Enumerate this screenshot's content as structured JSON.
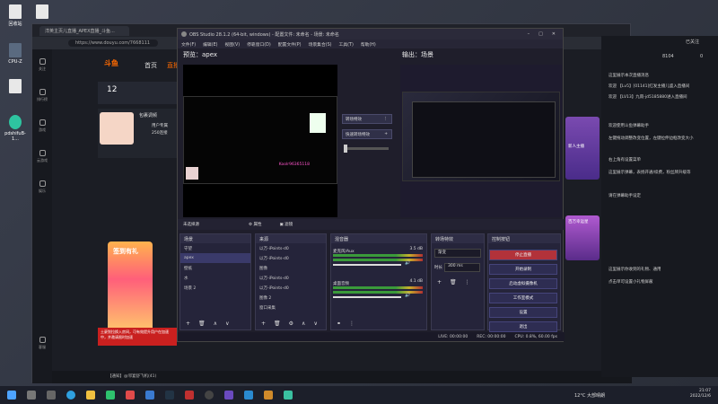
{
  "desktop": {
    "icons": [
      {
        "label": "回收站"
      },
      {
        "label": "CPU-Z"
      },
      {
        "label": "pdshifuB-1..."
      }
    ]
  },
  "browser": {
    "tab_title": "洋英主页儿直播_APEX直播_斗鱼...",
    "url": "https://www.douyu.com/7668111",
    "douyu": {
      "nav": [
        "首页",
        "直播"
      ],
      "sidebar": [
        "关注",
        "排行榜",
        "游戏",
        "云游戏",
        "娱乐",
        "客服"
      ],
      "stat_number": "12",
      "card_title": "包裹调频",
      "card_lines": [
        "用户专属",
        "250连接"
      ],
      "promo": "签到有礼",
      "toast": "土豪划拉换入房间，可有效提升用户在加速中，并邀请限时加速",
      "bottom_text": "【通知】@邻宴舒飞机(41)"
    }
  },
  "chat": {
    "header": "已关注",
    "lines": [
      "这里展示本次直播消息",
      "欢迎 【Lv5】[01141]红发主播儿盛入直播间",
      "欢迎 【LV13】九雨-jd5185880进入直播间",
      "欢迎使用斗鱼弹幕助手",
      "左键拖动调整改变位置，左键拉伸边框改变大小",
      "右上角有设置菜单",
      "这里展示弹幕，表扬开通/续费，粉丝牌升级等",
      "请在弹幕助手设定",
      "这里展示你收到的礼物、通用",
      "点击单可设置小礼物屏蔽"
    ],
    "banner_1": "新人主播",
    "banner_2": "百万幸运星",
    "counts": [
      "8104",
      "0"
    ]
  },
  "obs": {
    "title": "OBS Studio 28.1.2 (64-bit, windows) - 配置文件: 未命名 - 场景: 未命名",
    "menu": [
      "文件(F)",
      "编辑(E)",
      "视图(V)",
      "停靠窗口(D)",
      "配置文件(P)",
      "场景集合(S)",
      "工具(T)",
      "帮助(H)"
    ],
    "preview_label": "预览：apex",
    "program_label": "输出：场景",
    "transition_label": "转场特效",
    "quick_transition": "快速转场特效",
    "no_source": "未选择源",
    "props_btn": "属性",
    "filter_btn": "滤镜",
    "panels": {
      "scenes": {
        "title": "场景",
        "items": [
          "守望",
          "apex",
          "壁纸",
          "水",
          "场景 2"
        ],
        "selected": 1
      },
      "sources": {
        "title": "来源",
        "items": [
          "以万-iPoints-d0",
          "以万-iPoints-d0",
          "图像",
          "以万-iPoints-d0",
          "以万-iPoints-d0",
          "图像 2",
          "窗口采集"
        ]
      },
      "mixer": {
        "title": "混音器",
        "channels": [
          {
            "name": "麦克风/Aux",
            "db": "3.5 dB"
          },
          {
            "name": "桌面音频",
            "db": "4.1 dB"
          }
        ]
      },
      "transitions": {
        "title": "转场特效",
        "type": "渐变",
        "duration_label": "时长",
        "duration": "300 ms"
      },
      "controls": {
        "title": "控制按钮",
        "buttons": [
          "停止直播",
          "开始录制",
          "启动虚拟摄像机",
          "工作室模式",
          "设置",
          "退出"
        ]
      }
    },
    "watermark": "Koolr96365118",
    "status": {
      "live": "LIVE: 00:00:00",
      "rec": "REC: 00:00:00",
      "cpu": "CPU: 0.8%, 60.00 fps"
    }
  },
  "taskbar": {
    "weather": "12°C 大部晴朗",
    "time": "21:07",
    "date": "2022/12/6"
  }
}
